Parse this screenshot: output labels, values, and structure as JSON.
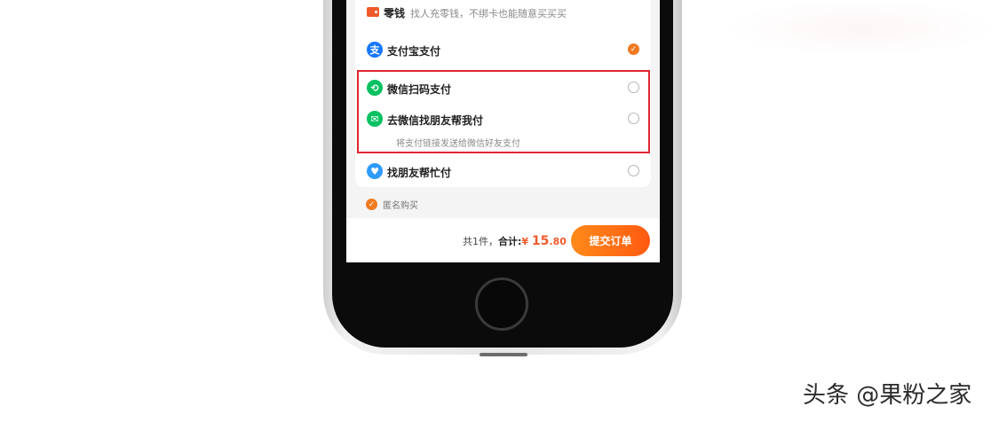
{
  "payment": {
    "change": {
      "label": "零钱",
      "desc": "找人充零钱，不绑卡也能随意买买买",
      "icon": "wallet-icon"
    },
    "alipay": {
      "label": "支付宝支付",
      "icon_glyph": "支",
      "icon": "alipay-icon",
      "selected": true
    },
    "wechat_scan": {
      "label": "微信扫码支付",
      "icon": "wechat-scan-icon",
      "selected": false
    },
    "wechat_friend": {
      "label": "去微信找朋友帮我付",
      "desc": "将支付链接发送给微信好友支付",
      "icon": "wechat-icon",
      "selected": false
    },
    "friend_help": {
      "label": "找朋友帮忙付",
      "icon": "friend-help-icon",
      "selected": false
    }
  },
  "anonymous": {
    "label": "匿名购买",
    "checked": true
  },
  "footer": {
    "count_text": "共1件，",
    "total_label": "合计:",
    "currency": "¥",
    "price_int": "15",
    "price_dec": ".80",
    "submit_label": "提交订单"
  },
  "watermark": "头条 @果粉之家",
  "colors": {
    "accent": "#f07a22",
    "alipay": "#1677ff",
    "wechat": "#07c160",
    "highlight": "#e0262d",
    "price": "#f05a2a"
  }
}
